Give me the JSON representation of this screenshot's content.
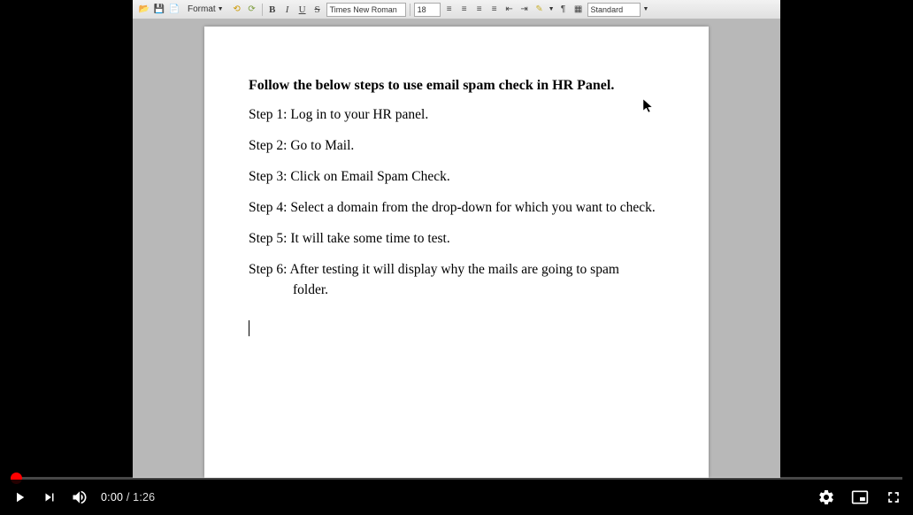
{
  "toolbar": {
    "format_label": "Format",
    "font_name": "Times New Roman",
    "font_size": "18",
    "style_name": "Standard"
  },
  "document": {
    "title": "Follow the below steps to use email spam check in HR Panel.",
    "steps": [
      "Step 1: Log in to your HR panel.",
      "Step 2: Go to Mail.",
      "Step 3: Click on Email Spam Check.",
      "Step 4: Select a domain from the drop-down for which you want to check.",
      "Step 5: It will take some time to test.",
      "Step 6: After testing it will display why the mails are going to spam"
    ],
    "step6_cont": "folder."
  },
  "player": {
    "current_time": "0:00",
    "duration": "1:26"
  }
}
